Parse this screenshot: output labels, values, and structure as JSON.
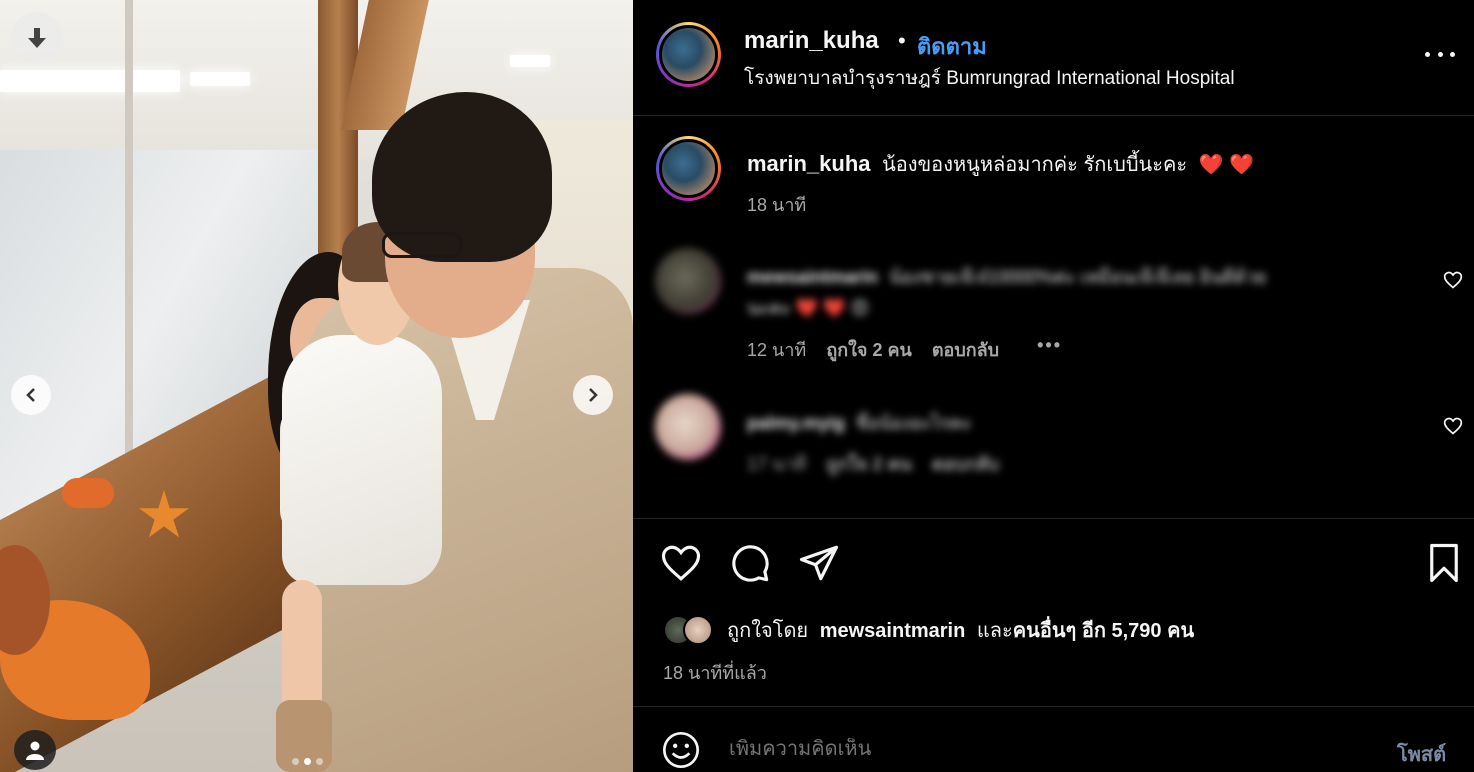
{
  "post": {
    "username": "marin_kuha",
    "separator": "•",
    "follow_label": "ติดตาม",
    "location": "โรงพยาบาลบำรุงราษฎร์ Bumrungrad International Hospital",
    "caption_username": "marin_kuha",
    "caption_text": "น้องของหนูหล่อมากค่ะ รักเบบี้นะคะ",
    "caption_emoji": "❤️ ❤️",
    "caption_time": "18 นาที"
  },
  "comments": [
    {
      "username": "mewsaintmarin",
      "text_line1": "น้องชายเจ๊เจ๋10000%ค่ะ เหมือนเจ๊เจ๊เลย อินดีด้วย",
      "text_line2": "นะคะ ❤️ ❤️ 😍",
      "time": "12 นาที",
      "likes": "ถูกใจ 2 คน",
      "reply": "ตอบกลับ",
      "more": "•••"
    },
    {
      "username": "palmy.myig",
      "text_line1": "ชื่อน้องอะไรคะ",
      "time": "17 นาที",
      "likes": "ถูกใจ 2 คน",
      "reply": "ตอบกลับ"
    }
  ],
  "likes": {
    "prefix": "ถูกใจโดย",
    "user": "mewsaintmarin",
    "joiner": "และ",
    "others": "คนอื่นๆ อีก 5,790 คน"
  },
  "post_time": "18 นาทีที่แล้ว",
  "comment_box": {
    "placeholder": "เพิ่มความคิดเห็น",
    "post_label": "โพสต์"
  },
  "carousel": {
    "current": 2,
    "total": 3
  },
  "colors": {
    "follow": "#4a9df7",
    "secondary_text": "#a8a8a8",
    "background": "#000000",
    "post_button": "#7a8aa6"
  }
}
